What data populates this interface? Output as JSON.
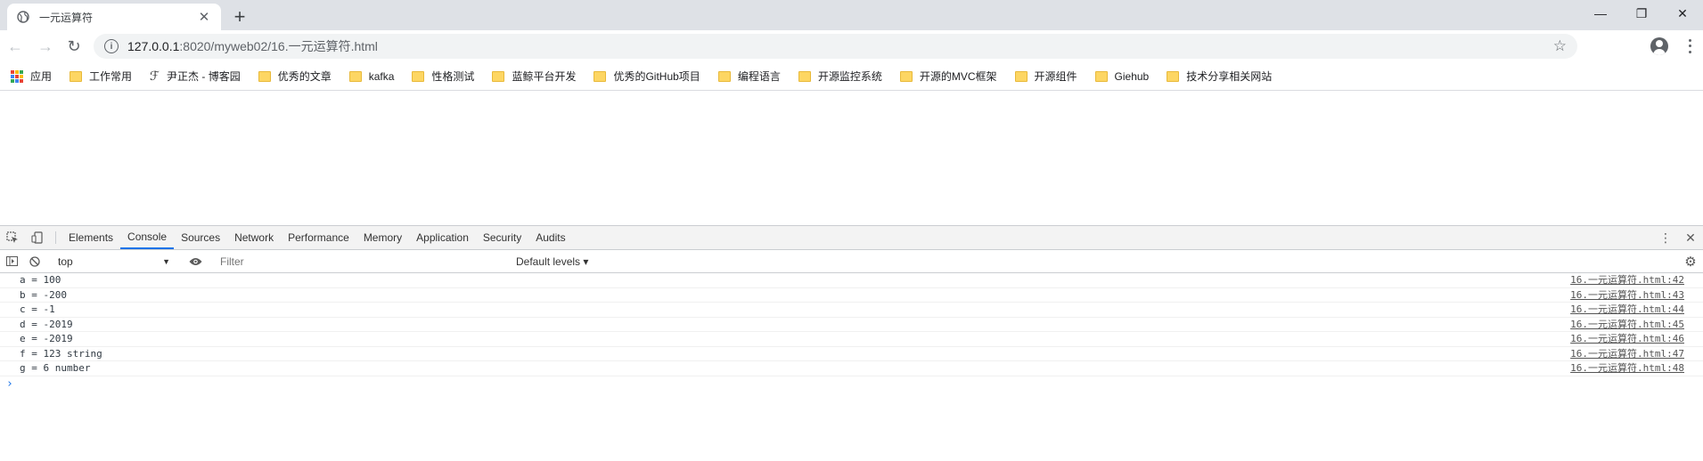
{
  "tab": {
    "title": "一元运算符",
    "favicon": "globe-icon",
    "close_glyph": "✕",
    "new_tab_glyph": "+"
  },
  "window_controls": {
    "minimize": "—",
    "restore": "❐",
    "close": "✕"
  },
  "toolbar": {
    "back_glyph": "←",
    "forward_glyph": "→",
    "reload_glyph": "↻",
    "url_host": "127.0.0.1",
    "url_path": ":8020/myweb02/16.一元运算符.html",
    "info_glyph": "i",
    "star_glyph": "☆"
  },
  "bookmarks": [
    {
      "label": "应用",
      "icon": "apps-grid-icon"
    },
    {
      "label": "工作常用",
      "icon": "folder-icon"
    },
    {
      "label": "尹正杰 - 博客园",
      "icon": "blog-icon"
    },
    {
      "label": "优秀的文章",
      "icon": "folder-icon"
    },
    {
      "label": "kafka",
      "icon": "folder-icon"
    },
    {
      "label": "性格测试",
      "icon": "folder-icon"
    },
    {
      "label": "蓝鲸平台开发",
      "icon": "folder-icon"
    },
    {
      "label": "优秀的GitHub项目",
      "icon": "folder-icon"
    },
    {
      "label": "编程语言",
      "icon": "folder-icon"
    },
    {
      "label": "开源监控系统",
      "icon": "folder-icon"
    },
    {
      "label": "开源的MVC框架",
      "icon": "folder-icon"
    },
    {
      "label": "开源组件",
      "icon": "folder-icon"
    },
    {
      "label": "Giehub",
      "icon": "folder-icon"
    },
    {
      "label": "技术分享相关网站",
      "icon": "folder-icon"
    }
  ],
  "devtools": {
    "tabs": [
      "Elements",
      "Console",
      "Sources",
      "Network",
      "Performance",
      "Memory",
      "Application",
      "Security",
      "Audits"
    ],
    "active_tab": "Console",
    "context": "top",
    "filter_placeholder": "Filter",
    "levels_label": "Default levels ▾",
    "accent_color": "#1a73e8"
  },
  "console": {
    "messages": [
      {
        "text": "a = 100",
        "source": "16.一元运算符.html:42"
      },
      {
        "text": "b = -200",
        "source": "16.一元运算符.html:43"
      },
      {
        "text": "c = -1",
        "source": "16.一元运算符.html:44"
      },
      {
        "text": "d = -2019",
        "source": "16.一元运算符.html:45"
      },
      {
        "text": "e = -2019",
        "source": "16.一元运算符.html:46"
      },
      {
        "text": "f = 123 string",
        "source": "16.一元运算符.html:47"
      },
      {
        "text": "g = 6 number",
        "source": "16.一元运算符.html:48"
      }
    ],
    "prompt_glyph": "›"
  }
}
